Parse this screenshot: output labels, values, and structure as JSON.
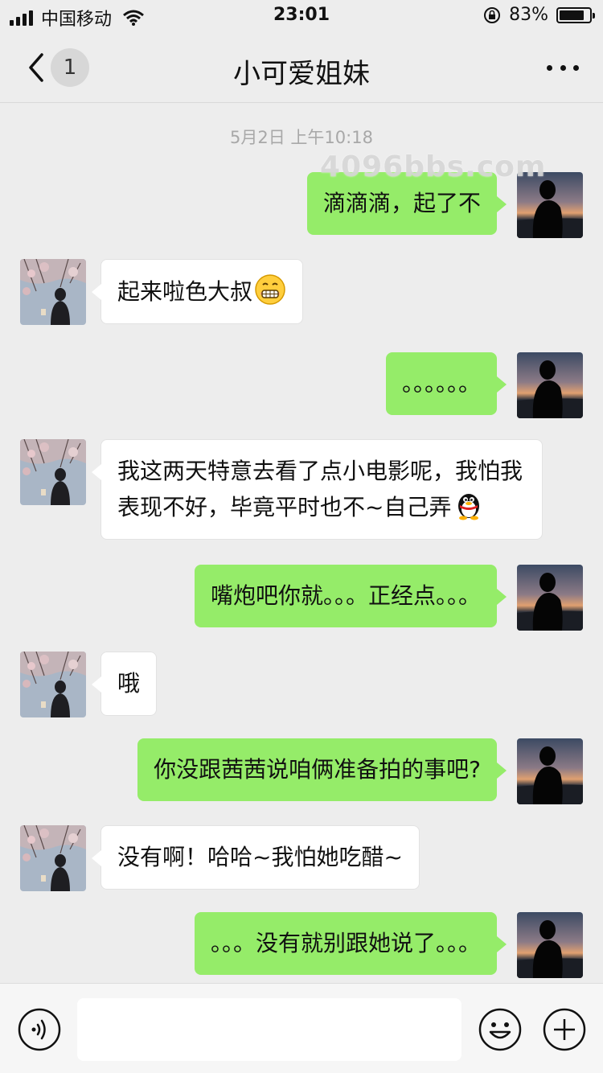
{
  "status_bar": {
    "carrier": "中国移动",
    "time": "23:01",
    "battery_text": "83%",
    "battery_level": 0.83,
    "icons": [
      "signal-icon",
      "wifi-icon",
      "rotation-lock-icon",
      "battery-icon"
    ]
  },
  "nav": {
    "back_icon": "chevron-left-icon",
    "unread_count": "1",
    "title": "小可爱姐妹",
    "more_icon": "more-dots-icon"
  },
  "chat": {
    "timestamp": "5月2日 上午10:18",
    "watermark": "4096bbs.com",
    "messages": [
      {
        "from": "me",
        "text": "滴滴滴，起了不"
      },
      {
        "from": "them",
        "text": "起来啦色大叔",
        "emoji": "grimacing-face-emoji"
      },
      {
        "from": "me",
        "text": "。。。。。。"
      },
      {
        "from": "them",
        "text": "我这两天特意去看了点小电影呢，我怕我表现不好，毕竟平时也不~自己弄",
        "emoji": "qq-penguin-emoji"
      },
      {
        "from": "me",
        "text": "嘴炮吧你就。。。正经点。。。"
      },
      {
        "from": "them",
        "text": "哦"
      },
      {
        "from": "me",
        "text": "你没跟茜茜说咱俩准备拍的事吧?"
      },
      {
        "from": "them",
        "text": "没有啊！哈哈~我怕她吃醋~"
      },
      {
        "from": "me",
        "text": "。。。没有就别跟她说了。。。"
      }
    ]
  },
  "input_bar": {
    "voice_icon": "voice-icon",
    "text_value": "",
    "emoji_icon": "smiley-icon",
    "plus_icon": "plus-icon"
  },
  "colors": {
    "background": "#ededed",
    "my_bubble": "#95ec69",
    "their_bubble": "#ffffff"
  }
}
